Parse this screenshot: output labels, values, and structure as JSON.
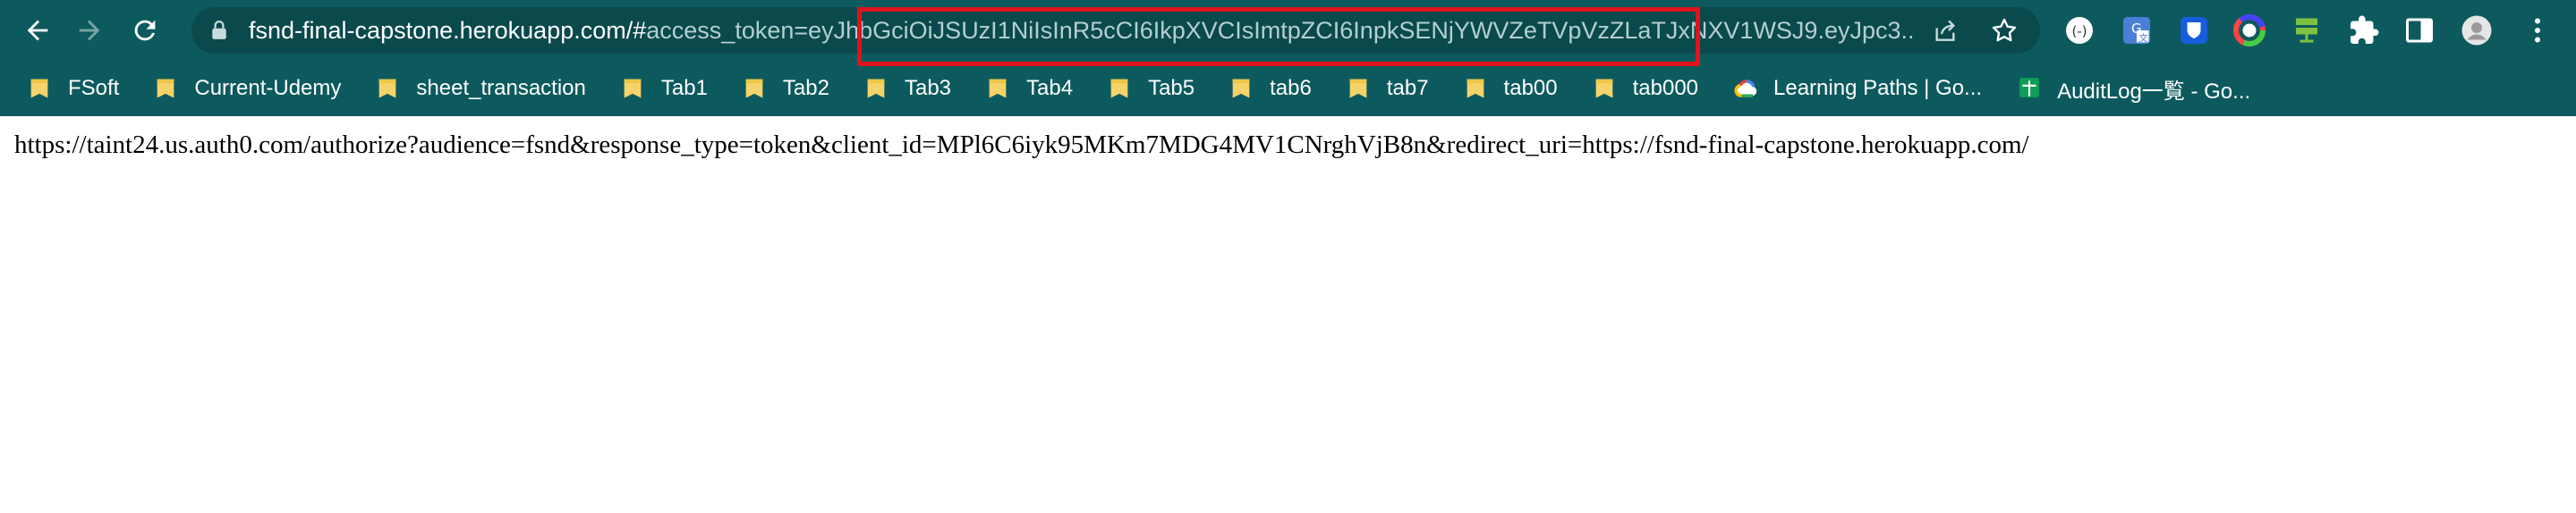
{
  "browser": {
    "url_host": "fsnd-final-capstone.herokuapp.com/#",
    "url_rest": "access_token=eyJhbGciOiJSUzI1NiIsInR5cCI6IkpXVCIsImtpZCI6InpkSENjYWVZeTVpVzZLaTJxNXV1WSJ9.eyJpc3..."
  },
  "bookmarks": [
    {
      "label": "FSoft",
      "icon": "folder-icon"
    },
    {
      "label": "Current-Udemy",
      "icon": "folder-icon"
    },
    {
      "label": "sheet_transaction",
      "icon": "folder-icon"
    },
    {
      "label": "Tab1",
      "icon": "folder-icon"
    },
    {
      "label": "Tab2",
      "icon": "folder-icon"
    },
    {
      "label": "Tab3",
      "icon": "folder-icon"
    },
    {
      "label": "Tab4",
      "icon": "folder-icon"
    },
    {
      "label": "Tab5",
      "icon": "folder-icon"
    },
    {
      "label": "tab6",
      "icon": "folder-icon"
    },
    {
      "label": "tab7",
      "icon": "folder-icon"
    },
    {
      "label": "tab00",
      "icon": "folder-icon"
    },
    {
      "label": "tab000",
      "icon": "folder-icon"
    },
    {
      "label": "Learning Paths | Go...",
      "icon": "google-cloud-icon"
    },
    {
      "label": "AuditLog一覧 - Go...",
      "icon": "google-sheets-icon"
    }
  ],
  "page": {
    "body_text": "https://taint24.us.auth0.com/authorize?audience=fsnd&response_type=token&client_id=MPl6C6iyk95MKm7MDG4MV1CNrghVjB8n&redirect_uri=https://fsnd-final-capstone.herokuapp.com/"
  },
  "colors": {
    "chrome_bg": "#0d5a5e",
    "omnibox_bg": "#0a494c",
    "highlight_border": "#e0121b"
  }
}
